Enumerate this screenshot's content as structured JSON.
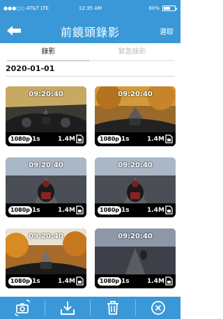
{
  "status_bar": {
    "carrier": "●●●○○ AT&T  LTE",
    "time": "12:35 AM",
    "battery_text": "60%",
    "battery_level": 0.6
  },
  "nav": {
    "title": "前鏡頭錄影",
    "select_label": "選取"
  },
  "tabs": [
    {
      "label": "錄影",
      "active": true
    },
    {
      "label": "緊急錄影",
      "active": false
    }
  ],
  "date": "2020-01-01",
  "videos": [
    {
      "timestamp": "09:20:40",
      "resolution": "1080p",
      "duration": "1s",
      "size": "1.4M",
      "scene": "rider-cockpit"
    },
    {
      "timestamp": "09:20:40",
      "resolution": "1080p",
      "duration": "1s",
      "size": "1.4M",
      "scene": "autumn-road"
    },
    {
      "timestamp": "09:20:40",
      "resolution": "1080p",
      "duration": "1s",
      "size": "1.4M",
      "scene": "rider-rear"
    },
    {
      "timestamp": "09:20:40",
      "resolution": "1080p",
      "duration": "1s",
      "size": "1.4M",
      "scene": "rider-rear"
    },
    {
      "timestamp": "09:20:40",
      "resolution": "1080p",
      "duration": "1s",
      "size": "1.4M",
      "scene": "autumn-handlebar"
    },
    {
      "timestamp": "09:20:40",
      "resolution": "1080p",
      "duration": "1s",
      "size": "1.4M",
      "scene": "road-rider"
    }
  ],
  "toolbar": [
    {
      "icon": "rotate-camera-icon"
    },
    {
      "icon": "download-icon"
    },
    {
      "icon": "trash-icon"
    },
    {
      "icon": "close-circle-icon"
    }
  ],
  "colors": {
    "accent": "#3a98d8"
  }
}
